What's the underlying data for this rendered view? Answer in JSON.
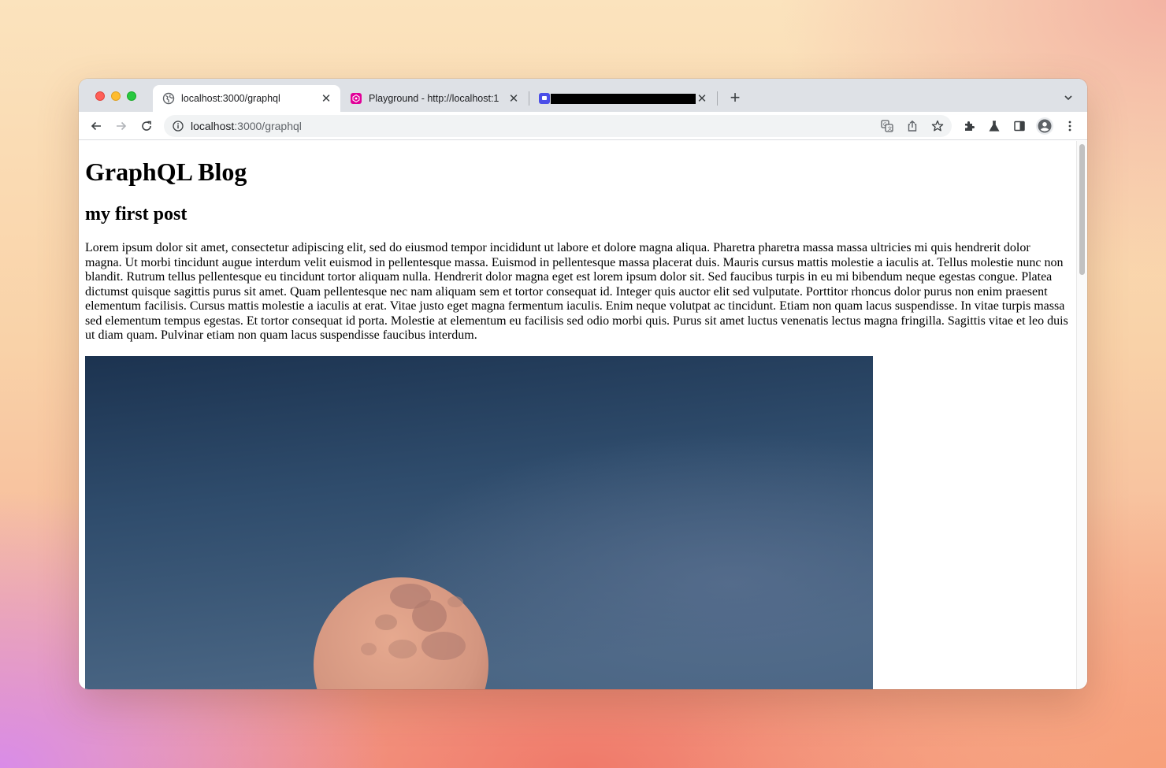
{
  "browser": {
    "tabs": [
      {
        "title": "localhost:3000/graphql",
        "favicon": "globe-icon",
        "active": true
      },
      {
        "title": "Playground - http://localhost:1",
        "favicon": "graphql-playground-icon",
        "active": false
      },
      {
        "title": "",
        "favicon": "app-icon",
        "active": false,
        "redacted": true
      }
    ],
    "new_tab_label": "+",
    "address": {
      "host": "localhost",
      "path": ":3000/graphql"
    },
    "toolbar_icons": [
      "back-arrow-icon",
      "forward-arrow-icon",
      "reload-icon",
      "info-icon",
      "translate-icon",
      "share-icon",
      "bookmark-star-icon",
      "extensions-icon",
      "labs-icon",
      "side-panel-icon",
      "profile-icon",
      "menu-kebab-icon"
    ]
  },
  "page": {
    "heading": "GraphQL Blog",
    "post": {
      "title": "my first post",
      "body": "Lorem ipsum dolor sit amet, consectetur adipiscing elit, sed do eiusmod tempor incididunt ut labore et dolore magna aliqua. Pharetra pharetra massa massa ultricies mi quis hendrerit dolor magna. Ut morbi tincidunt augue interdum velit euismod in pellentesque massa. Euismod in pellentesque massa placerat duis. Mauris cursus mattis molestie a iaculis at. Tellus molestie nunc non blandit. Rutrum tellus pellentesque eu tincidunt tortor aliquam nulla. Hendrerit dolor magna eget est lorem ipsum dolor sit. Sed faucibus turpis in eu mi bibendum neque egestas congue. Platea dictumst quisque sagittis purus sit amet. Quam pellentesque nec nam aliquam sem et tortor consequat id. Integer quis auctor elit sed vulputate. Porttitor rhoncus dolor purus non enim praesent elementum facilisis. Cursus mattis molestie a iaculis at erat. Vitae justo eget magna fermentum iaculis. Enim neque volutpat ac tincidunt. Etiam non quam lacus suspendisse. In vitae turpis massa sed elementum tempus egestas. Et tortor consequat id porta. Molestie at elementum eu facilisis sed odio morbi quis. Purus sit amet luctus venenatis lectus magna fringilla. Sagittis vitae et leo duis ut diam quam. Pulvinar etiam non quam lacus suspendisse faucibus interdum.",
      "image": "full-moon-night-sky-photo"
    }
  },
  "colors": {
    "tabstrip": "#dee1e6",
    "sky_top": "#1c3452",
    "sky_bottom": "#4c6a88",
    "moon": "#d99a85"
  }
}
